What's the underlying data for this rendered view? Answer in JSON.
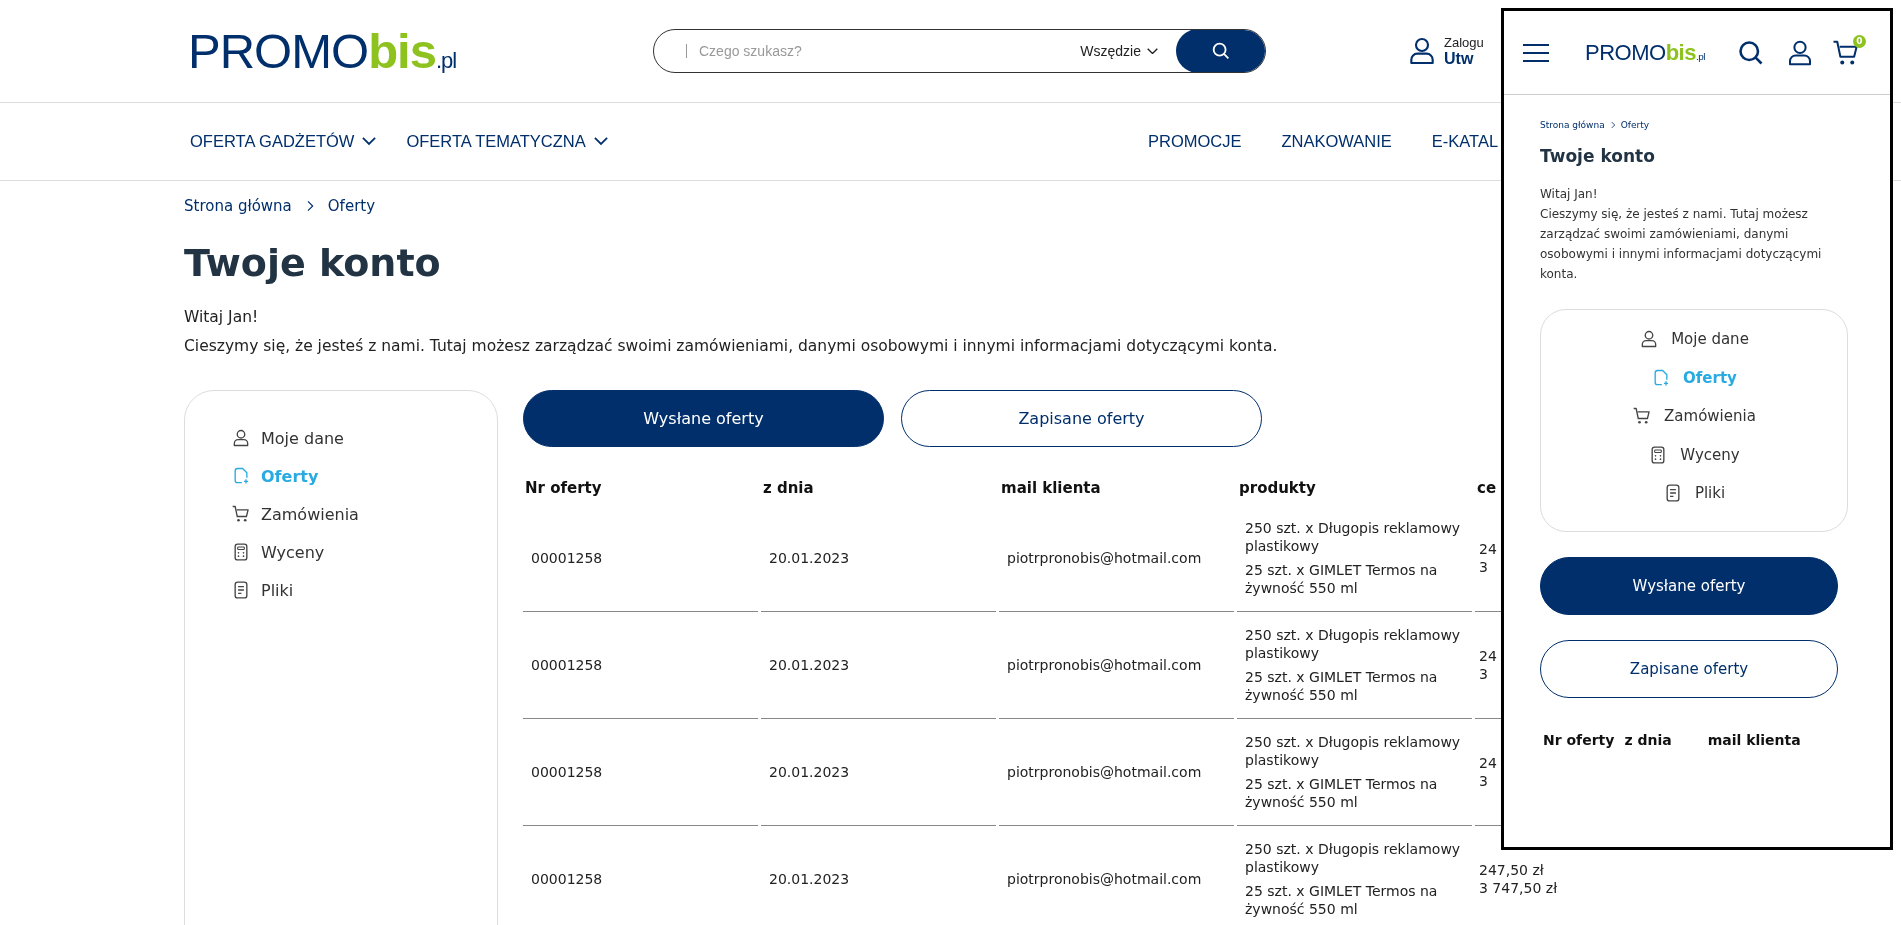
{
  "header": {
    "logo": {
      "main": "PROMO",
      "accent": "bis",
      "suffix": ".pl"
    },
    "search": {
      "placeholder": "Czego szukasz?",
      "scope": "Wszędzie"
    },
    "account": {
      "line_1": "Zalogu",
      "line_2": "Utw"
    }
  },
  "nav": {
    "left": [
      {
        "label": "OFERTA GADŻETÓW",
        "dropdown": true
      },
      {
        "label": "OFERTA TEMATYCZNA",
        "dropdown": true
      }
    ],
    "right": [
      "PROMOCJE",
      "ZNAKOWANIE",
      "E-KATAL"
    ]
  },
  "breadcrumb": [
    "Strona główna",
    "Oferty"
  ],
  "title": "Twoje konto",
  "greeting": "Witaj Jan!",
  "intro": "Cieszymy się, że jesteś z nami. Tutaj możesz zarządzać swoimi zamówieniami, danymi osobowymi i innymi informacjami dotyczącymi konta.",
  "sidebar": {
    "items": [
      {
        "label": "Moje dane",
        "kind": "user",
        "selected": false
      },
      {
        "label": "Oferty",
        "kind": "document",
        "selected": true
      },
      {
        "label": "Zamówienia",
        "kind": "cart",
        "selected": false
      },
      {
        "label": "Wyceny",
        "kind": "calculator",
        "selected": false
      },
      {
        "label": "Pliki",
        "kind": "file",
        "selected": false
      }
    ]
  },
  "offer_tabs": [
    {
      "label": "Wysłane oferty",
      "selected": true
    },
    {
      "label": "Zapisane oferty",
      "selected": false
    }
  ],
  "table": {
    "columns": [
      "Nr oferty",
      "z dnia",
      "mail klienta",
      "produkty",
      "ce"
    ],
    "rows": [
      {
        "number": "00001258",
        "date": "20.01.2023",
        "email": "piotrpronobis@hotmail.com",
        "products": [
          "250 szt. x Długopis reklamowy plastikowy",
          "25 szt. x GIMLET Termos na żywność 550 ml"
        ],
        "prices": [
          "24",
          "3"
        ]
      },
      {
        "number": "00001258",
        "date": "20.01.2023",
        "email": "piotrpronobis@hotmail.com",
        "products": [
          "250 szt. x Długopis reklamowy plastikowy",
          "25 szt. x GIMLET Termos na żywność 550 ml"
        ],
        "prices": [
          "24",
          "3"
        ]
      },
      {
        "number": "00001258",
        "date": "20.01.2023",
        "email": "piotrpronobis@hotmail.com",
        "products": [
          "250 szt. x Długopis reklamowy plastikowy",
          "25 szt. x GIMLET Termos na żywność 550 ml"
        ],
        "prices": [
          "24",
          "3"
        ]
      },
      {
        "number": "00001258",
        "date": "20.01.2023",
        "email": "piotrpronobis@hotmail.com",
        "products": [
          "250 szt. x Długopis reklamowy plastikowy",
          "25 szt. x GIMLET Termos na żywność 550 ml"
        ],
        "prices": [
          "247,50 zł",
          "3 747,50 zł"
        ]
      }
    ]
  },
  "mobile": {
    "logo": {
      "main": "PROMO",
      "accent": "bis",
      "suffix": ".pl"
    },
    "cart_count": "0",
    "breadcrumb": [
      "Strona główna",
      "Oferty"
    ],
    "title": "Twoje konto",
    "greeting": "Witaj Jan!",
    "intro": "Cieszymy się, że jesteś z nami. Tutaj możesz zarządzać swoimi zamówieniami, danymi osobowymi i innymi informacjami dotyczącymi konta.",
    "menu": [
      {
        "label": "Moje dane",
        "kind": "user",
        "selected": false
      },
      {
        "label": "Oferty",
        "kind": "document",
        "selected": true
      },
      {
        "label": "Zamówienia",
        "kind": "cart",
        "selected": false
      },
      {
        "label": "Wyceny",
        "kind": "calculator",
        "selected": false
      },
      {
        "label": "Pliki",
        "kind": "file",
        "selected": false
      }
    ],
    "offer_tabs": [
      {
        "label": "Wysłane oferty",
        "selected": true
      },
      {
        "label": "Zapisane oferty",
        "selected": false
      }
    ],
    "columns": [
      "Nr oferty",
      "z dnia",
      "mail klienta"
    ]
  }
}
